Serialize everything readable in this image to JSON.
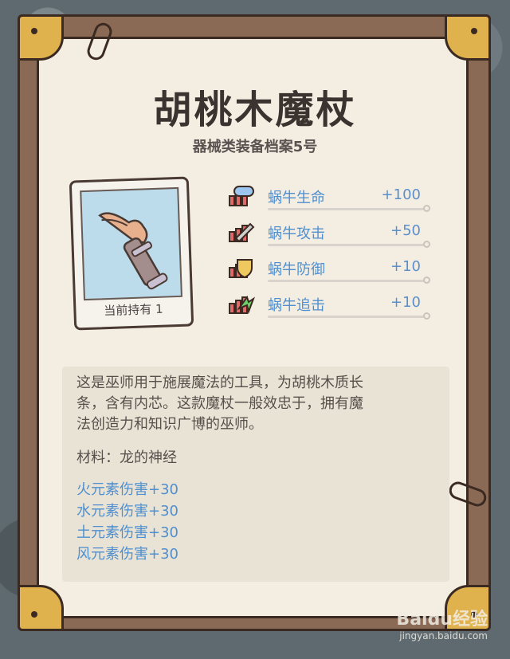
{
  "item": {
    "title": "胡桃木魔杖",
    "subtitle": "器械类装备档案5号",
    "card_label": "当前持有 1"
  },
  "stats": [
    {
      "name": "蜗牛生命",
      "value": "+100",
      "icon": "health-icon"
    },
    {
      "name": "蜗牛攻击",
      "value": "+50",
      "icon": "attack-icon"
    },
    {
      "name": "蜗牛防御",
      "value": "+10",
      "icon": "defense-icon"
    },
    {
      "name": "蜗牛追击",
      "value": "+10",
      "icon": "pursuit-icon"
    }
  ],
  "description": {
    "line1": "这是巫师用于施展魔法的工具，为胡桃木质长",
    "line2": "条，含有内芯。这款魔杖一般效忠于，拥有魔",
    "line3": "法创造力和知识广博的巫师。",
    "material": "材料：龙的神经"
  },
  "bonuses": [
    "火元素伤害+30",
    "水元素伤害+30",
    "土元素伤害+30",
    "风元素伤害+30"
  ],
  "watermark": {
    "brand": "Baidu经验",
    "url": "jingyan.baidu.com"
  },
  "colors": {
    "stat_text": "#4f8fcf",
    "frame": "#8a6a55",
    "paper": "#f4eee2",
    "corner": "#e0b24e"
  }
}
